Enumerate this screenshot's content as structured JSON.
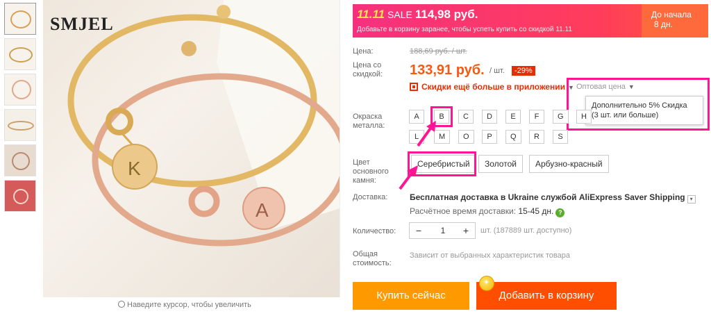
{
  "gallery": {
    "brand_logo": "SMJEL",
    "zoom_hint": "Наведите курсор, чтобы увеличить",
    "thumbnail_count": 6
  },
  "sale_banner": {
    "event_tag": "11.11",
    "sale_label": "SALE",
    "sale_price": "114,98 руб.",
    "subtitle": "Добавьте в корзину заранее, чтобы успеть купить со скидкой 11.11",
    "countdown_line1": "До начала",
    "countdown_line2": "8 дн."
  },
  "price": {
    "label": "Цена:",
    "original": "188,69 руб. / шт.",
    "discount_label": "Цена со скидкой:",
    "discounted": "133,91 руб.",
    "per_unit": "/ шт.",
    "discount_badge": "-29%",
    "app_discount_link": "Скидки ещё больше в приложении",
    "wholesale_label": "Оптовая цена",
    "wholesale_tooltip_line1": "Дополнительно 5% Скидка",
    "wholesale_tooltip_line2": "(3 шт. или больше)"
  },
  "metal_color": {
    "label": "Окраска металла:",
    "row1": [
      "A",
      "B",
      "C",
      "D",
      "E",
      "F",
      "G",
      "H"
    ],
    "row2": [
      "L",
      "M",
      "O",
      "P",
      "Q",
      "R",
      "S"
    ],
    "highlighted": "B"
  },
  "stone_color": {
    "label": "Цвет основного камня:",
    "options": [
      "Серебристый",
      "Золотой",
      "Арбузно-красный"
    ],
    "highlighted": "Серебристый"
  },
  "shipping": {
    "label": "Доставка:",
    "value": "Бесплатная доставка в Ukraine службой AliExpress Saver Shipping",
    "time_label": "Расчётное время доставки:",
    "time_value": "15-45 дн."
  },
  "quantity": {
    "label": "Количество:",
    "minus": "−",
    "value": "1",
    "plus": "+",
    "available": "шт. (187889 шт. доступно)"
  },
  "total": {
    "label": "Общая стоимость:",
    "note": "Зависит от выбранных характеристик товара"
  },
  "actions": {
    "buy_now": "Купить сейчас",
    "add_to_cart": "Добавить в корзину"
  },
  "colors": {
    "accent_orange": "#f35a12",
    "highlight_pink": "#ff1493",
    "buy_button": "#ff9900",
    "cart_button": "#ff4e00"
  }
}
